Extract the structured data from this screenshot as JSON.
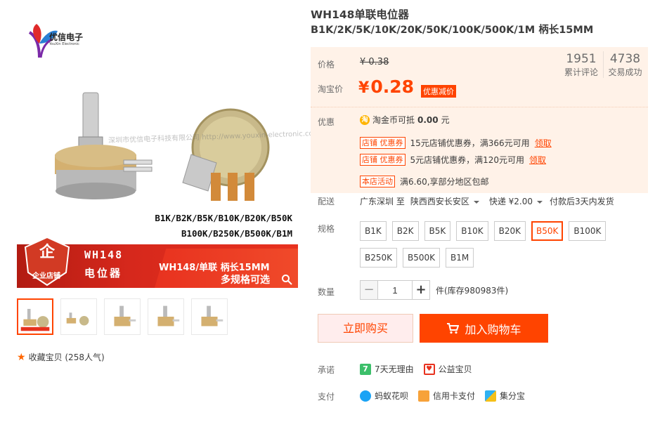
{
  "brand": {
    "logo_name": "优信电子",
    "logo_sub": "YouXin Electronic"
  },
  "gallery": {
    "watermark": "深圳市优信电子科技有限公司 http://www.youxin-electronic.com",
    "spec_line1": "B1K/B2K/B5K/B10K/B20K/B50K",
    "spec_line2": "B100K/B250K/B500K/B1M",
    "badge_label": "企业店铺",
    "banner_title1": "WH148",
    "banner_title2": "电位器",
    "banner_right1": "WH148/单联 柄长15MM",
    "banner_right2": "多规格可选",
    "thumb_count": 5,
    "favorite": "收藏宝贝 (258人气)"
  },
  "product": {
    "title_line1": "WH148单联电位器",
    "title_line2": "B1K/2K/5K/10K/20K/50K/100K/500K/1M 柄长15MM"
  },
  "price": {
    "label_price": "价格",
    "original": "¥ 0.38",
    "label_taobao": "淘宝价",
    "currency": "¥",
    "promo": "0.28",
    "promo_tag": "优惠减价",
    "reviews_count": "1951",
    "reviews_label": "累计评论",
    "sales_count": "4738",
    "sales_label": "交易成功"
  },
  "offers": {
    "label": "优惠",
    "coin_icon": "淘",
    "coin_text_prefix": "淘金币可抵",
    "coin_amount": "0.00",
    "coin_text_suffix": "元",
    "coupons": [
      {
        "tag": "店铺 优惠券",
        "text": "15元店铺优惠券，满366元可用",
        "link": "领取"
      },
      {
        "tag": "店铺 优惠券",
        "text": "5元店铺优惠券，满120元可用",
        "link": "领取"
      }
    ],
    "activity_tag": "本店活动",
    "activity_text": "满6.60,享部分地区包邮"
  },
  "shipping": {
    "label": "配送",
    "from": "广东深圳 至",
    "to": "陕西西安长安区",
    "express": "快递 ¥2.00",
    "eta": "付款后3天内发货"
  },
  "specs": {
    "label": "规格",
    "options": [
      "B1K",
      "B2K",
      "B5K",
      "B10K",
      "B20K",
      "B50K",
      "B100K",
      "B250K",
      "B500K",
      "B1M"
    ],
    "selected": "B50K"
  },
  "quantity": {
    "label": "数量",
    "value": "1",
    "minus": "−",
    "plus": "+",
    "stock": "件(库存980983件)"
  },
  "actions": {
    "buy_now": "立即购买",
    "add_cart": "加入购物车"
  },
  "promise": {
    "label": "承诺",
    "items": [
      "7天无理由",
      "公益宝贝"
    ]
  },
  "payment": {
    "label": "支付",
    "items": [
      "蚂蚁花呗",
      "信用卡支付",
      "集分宝"
    ]
  },
  "colors": {
    "accent": "#ff4400",
    "price_bg": "#fff2e8",
    "buy_bg": "#ffeded"
  }
}
